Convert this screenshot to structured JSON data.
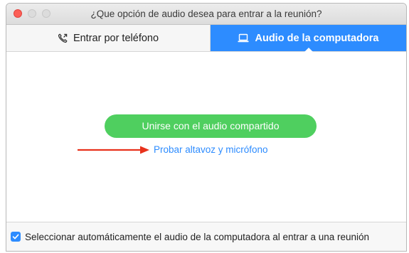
{
  "window": {
    "title": "¿Que opción de audio desea para entrar a la reunión?"
  },
  "tabs": [
    {
      "label": "Entrar por teléfono",
      "icon": "phone-icon",
      "selected": false
    },
    {
      "label": "Audio de la computadora",
      "icon": "laptop-icon",
      "selected": true
    }
  ],
  "main": {
    "join_button_label": "Unirse con el audio compartido",
    "test_link_label": "Probar altavoz y micrófono"
  },
  "footer": {
    "auto_select_checked": true,
    "auto_select_label": "Seleccionar automáticamente el audio de la computadora al entrar a una reunión"
  },
  "colors": {
    "accent_blue": "#2d8cff",
    "join_green": "#4fcf5f",
    "annotation_arrow": "#e8321c"
  }
}
